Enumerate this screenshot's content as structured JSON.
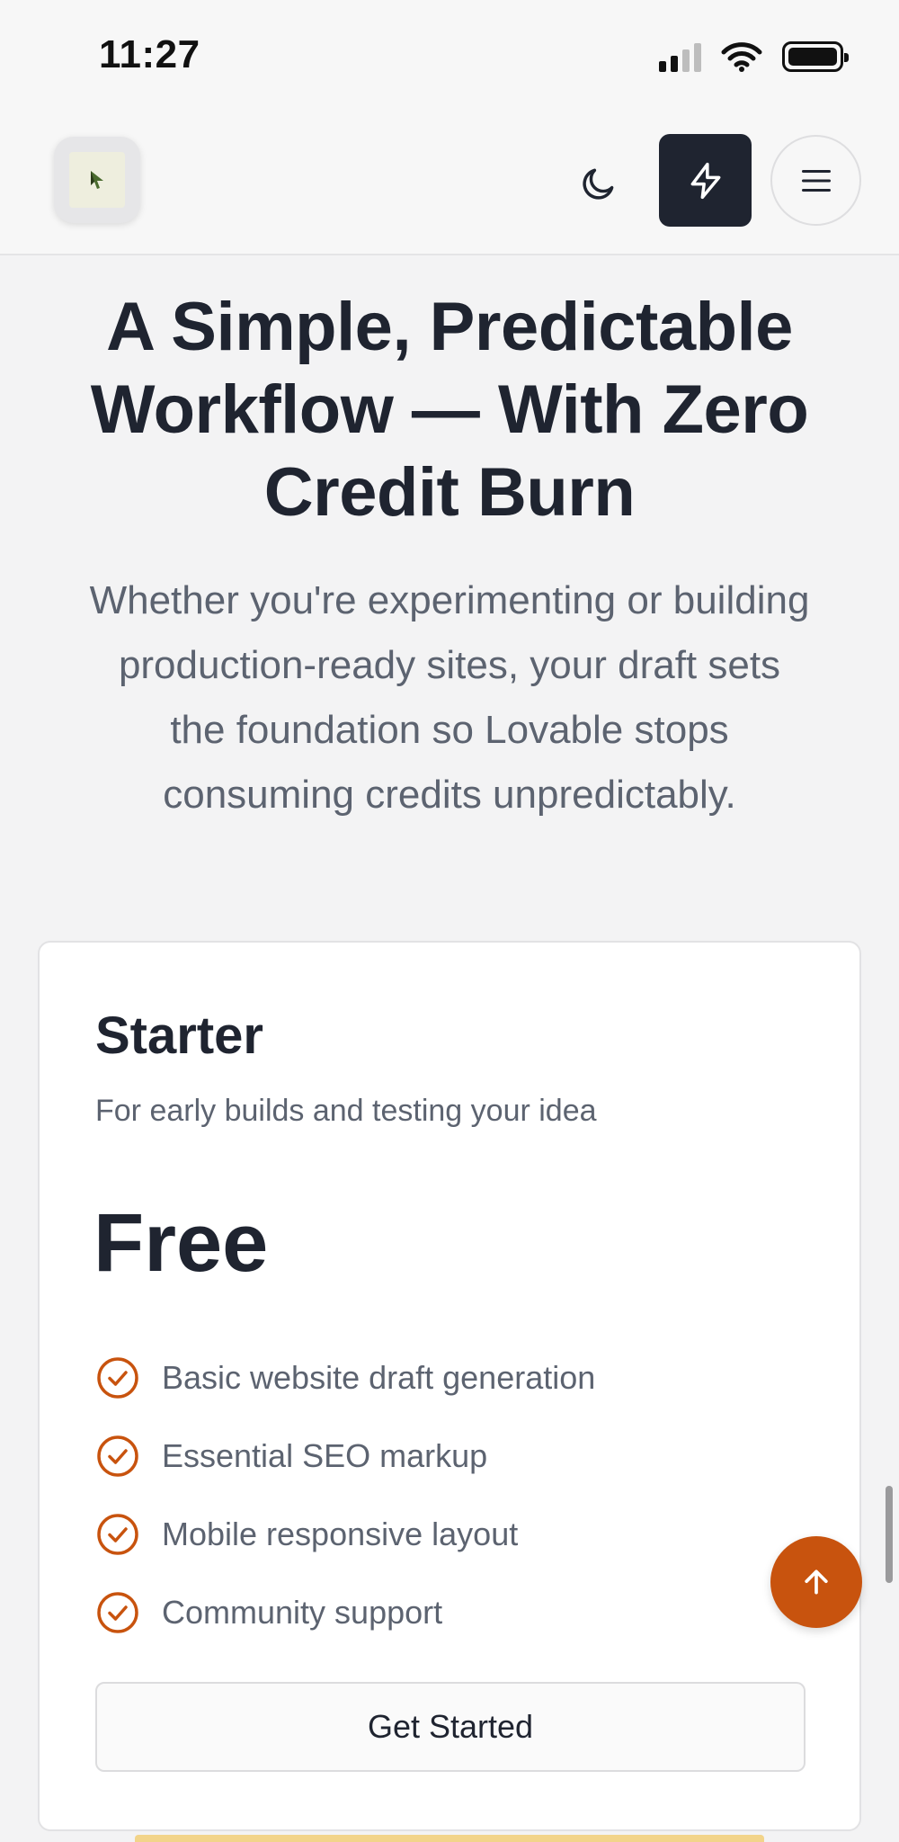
{
  "status_bar": {
    "time": "11:27",
    "icons": [
      "cellular-signal-icon",
      "wifi-icon",
      "battery-icon"
    ]
  },
  "header": {
    "logo_icon": "cursor-logo-icon",
    "theme_toggle_icon": "moon-icon",
    "quick_action_icon": "lightning-bolt-icon",
    "menu_icon": "hamburger-menu-icon"
  },
  "hero": {
    "headline_line1": "A Simple, Predictable",
    "headline_line2": "Workflow — With Zero",
    "headline_line3": "Credit Burn",
    "subhead_line1": "Whether you're experimenting or building",
    "subhead_line2": "production-ready sites, your draft sets",
    "subhead_line3": "the foundation so Lovable stops",
    "subhead_line4": "consuming credits unpredictably."
  },
  "plan": {
    "name": "Starter",
    "description": "For early builds and testing your idea",
    "price": "Free",
    "features": [
      "Basic website draft generation",
      "Essential SEO markup",
      "Mobile responsive layout",
      "Community support"
    ],
    "cta_label": "Get Started"
  },
  "floating": {
    "scroll_top_icon": "arrow-up-icon"
  },
  "colors": {
    "accent": "#c8530e",
    "dark": "#1f2430",
    "muted_text": "#5c6370",
    "page_bg": "#f3f3f4"
  }
}
